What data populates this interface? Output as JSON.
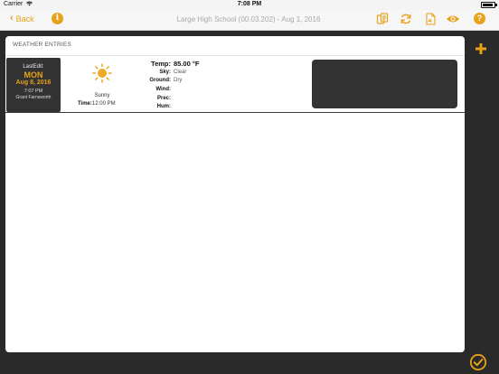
{
  "status": {
    "carrier": "Carrier",
    "time": "7:08 PM",
    "battery_level": 0.9
  },
  "nav": {
    "back_label": "Back",
    "title": "Large High School (00.03.202) - Aug 1, 2016",
    "icons": [
      "copy-icon",
      "refresh-icon",
      "pdf-icon",
      "eye-icon",
      "help-icon"
    ]
  },
  "panel": {
    "header": "WEATHER ENTRIES"
  },
  "entry": {
    "last_edit_label": "LastEdit:",
    "day": "MON",
    "date": "Aug 8, 2016",
    "time": "7:07 PM",
    "user": "Grant Farnsworth",
    "condition": "Sunny",
    "time_label": "Time:",
    "time_value": "12:00 PM",
    "fields": [
      {
        "key": "Temp:",
        "value": "85.00 °F"
      },
      {
        "key": "Sky:",
        "value": "Clear"
      },
      {
        "key": "Ground:",
        "value": "Dry"
      },
      {
        "key": "Wind:",
        "value": ""
      },
      {
        "key": "Prec:",
        "value": ""
      },
      {
        "key": "Hum:",
        "value": ""
      }
    ]
  },
  "colors": {
    "accent": "#e8a21a",
    "dark": "#2a2a2a",
    "panel": "#ffffff"
  }
}
